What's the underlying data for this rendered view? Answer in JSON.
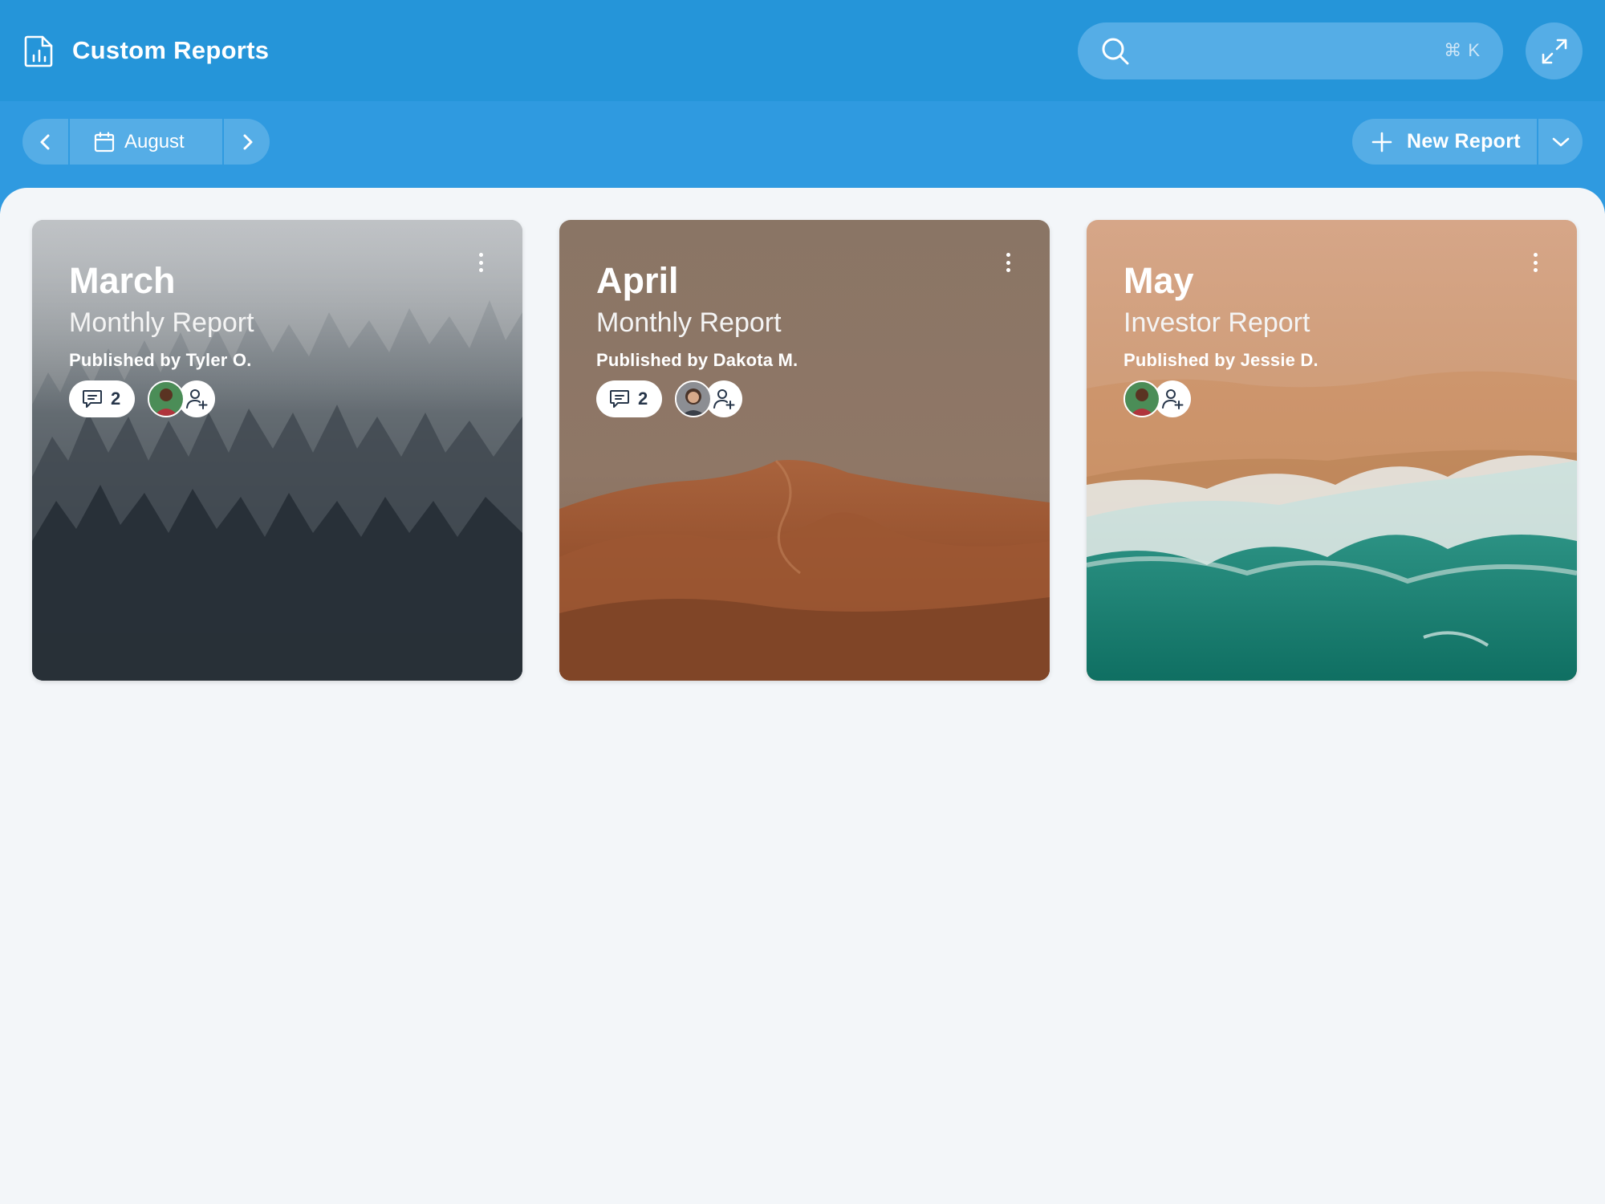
{
  "app": {
    "title": "Custom Reports",
    "icon": "report-chart-icon"
  },
  "search": {
    "placeholder": "",
    "shortcut": "⌘ K",
    "icon": "search-icon"
  },
  "toolbar": {
    "expand_icon": "expand-icon",
    "month_label": "August",
    "prev_icon": "chevron-left-icon",
    "next_icon": "chevron-right-icon",
    "calendar_icon": "calendar-icon",
    "new_report_label": "New Report",
    "new_report_icon": "plus-icon",
    "new_report_menu_icon": "chevron-down-icon"
  },
  "cards": [
    {
      "month": "March",
      "report_type": "Monthly Report",
      "publisher": "Published by Tyler O.",
      "comments": "2",
      "theme": "foggy-forest"
    },
    {
      "month": "April",
      "report_type": "Monthly Report",
      "publisher": "Published by Dakota M.",
      "comments": "2",
      "theme": "desert-dunes"
    },
    {
      "month": "May",
      "report_type": "Investor Report",
      "publisher": "Published by Jessie D.",
      "theme": "ocean-shore"
    }
  ],
  "colors": {
    "header": "#2595d9",
    "subheader": "#2f9ae0",
    "control": "#55ade6",
    "background": "#f3f6f9",
    "badge_text": "#27364a"
  }
}
